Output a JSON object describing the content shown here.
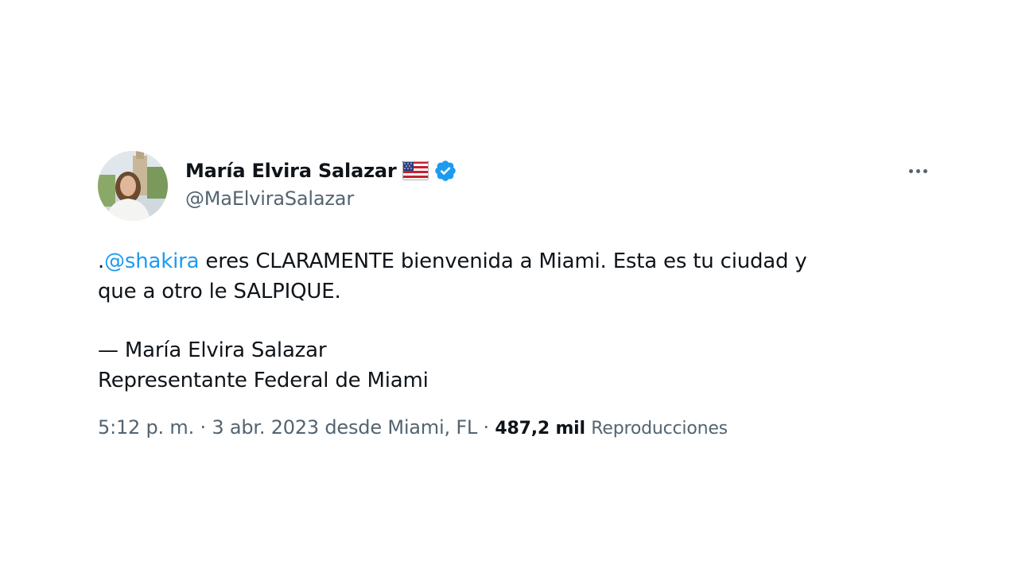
{
  "author": {
    "display_name": "María Elvira Salazar",
    "handle": "@MaElviraSalazar",
    "flag_icon": "us-flag-icon",
    "verified_icon": "verified-badge-icon",
    "verified_color": "#1d9bf0"
  },
  "menu": {
    "icon": "more-options-icon"
  },
  "tweet": {
    "prefix": ".",
    "mention": "@shakira",
    "line1_rest": " eres CLARAMENTE bienvenida a Miami. Esta es tu ciudad y",
    "line2": "que a otro le SALPIQUE.",
    "signature_line1": "— María Elvira Salazar",
    "signature_line2": "Representante Federal de Miami"
  },
  "meta": {
    "time": "5:12 p. m.",
    "separator": " · ",
    "date_location": "3 abr. 2023 desde Miami, FL",
    "views_count": "487,2 mil",
    "views_label": "Reproducciones"
  },
  "colors": {
    "link": "#1d9bf0",
    "secondary_text": "#536471",
    "primary_text": "#0f1419"
  }
}
